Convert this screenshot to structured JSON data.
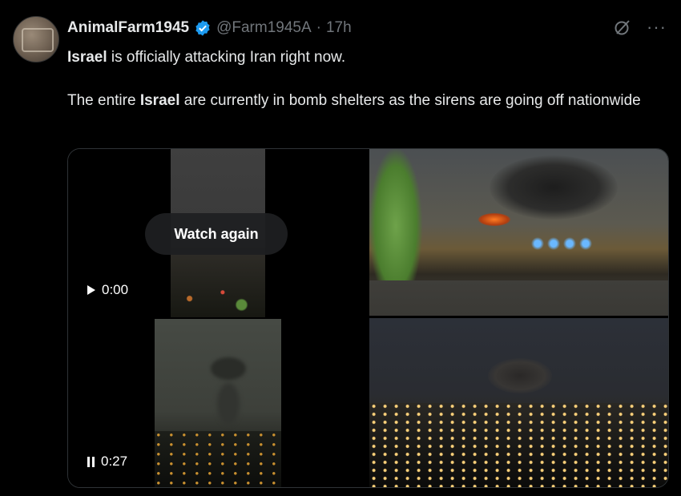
{
  "tweet": {
    "display_name": "AnimalFarm1945",
    "handle": "@Farm1945A",
    "separator": "·",
    "time": "17h",
    "paragraph1_bold": "Israel",
    "paragraph1_rest": " is officially attacking Iran right now.",
    "paragraph2_pre": "The entire ",
    "paragraph2_bold": "Israel",
    "paragraph2_rest": " are currently in bomb shelters as the sirens are going off nationwide"
  },
  "media": {
    "video": {
      "watch_again_label": "Watch again",
      "time1": "0:00",
      "time2": "0:27"
    }
  },
  "icons": {
    "verified": "verified-badge-icon",
    "grok": "grok-icon",
    "more": "more-icon",
    "play": "play-icon",
    "pause": "pause-icon"
  },
  "colors": {
    "background": "#000000",
    "text": "#e7e9ea",
    "muted": "#71767b",
    "verified": "#1d9bf0"
  }
}
